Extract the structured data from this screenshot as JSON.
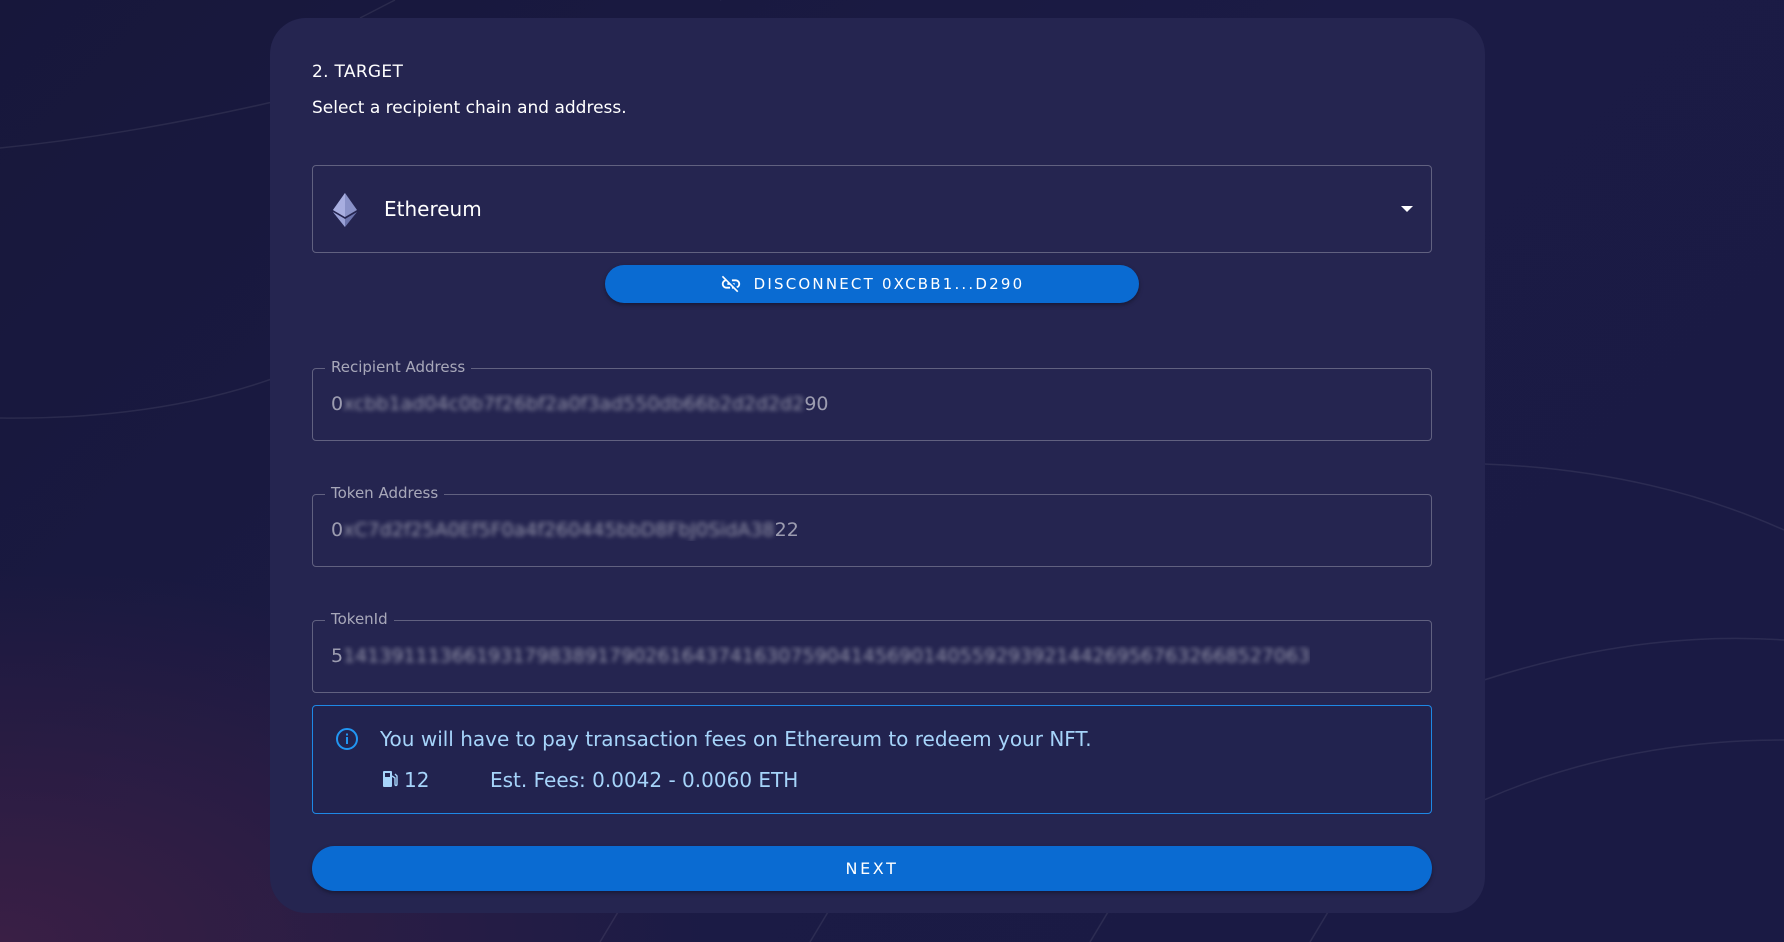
{
  "step": {
    "title": "2. TARGET",
    "subtitle": "Select a recipient chain and address."
  },
  "chain_select": {
    "selected": "Ethereum",
    "icon": "ethereum-icon"
  },
  "wallet": {
    "disconnect_label": "Disconnect 0xCBB1...D290",
    "icon": "link-off-icon"
  },
  "fields": {
    "recipient": {
      "label": "Recipient Address",
      "value_prefix": "0",
      "value_redacted": "xcbb1ad04c0b7f26bf2a0f3ad550db66b2d2d2d2",
      "value_suffix": "90"
    },
    "token": {
      "label": "Token Address",
      "value_prefix": "0",
      "value_redacted": "xC7d2f25A0Ef5F0a4f260445bbD8FbJ0SidA38",
      "value_suffix": "22"
    },
    "token_id": {
      "label": "TokenId",
      "value_prefix": "5",
      "value_redacted": "14139111366193179838917902616437416307590414569014055929392144269567632668527063",
      "value_suffix": ""
    }
  },
  "fee_info": {
    "message": "You will have to pay transaction fees on Ethereum to redeem your NFT.",
    "gas_price": "12",
    "estimate": "Est. Fees: 0.0042 - 0.0060 ETH",
    "color": "#a6d4fa",
    "border_color": "#1e88e5"
  },
  "next_button": {
    "label": "NEXT"
  },
  "colors": {
    "accent": "#0a6bd2",
    "card": "#252550",
    "background": "#1b1b45"
  }
}
